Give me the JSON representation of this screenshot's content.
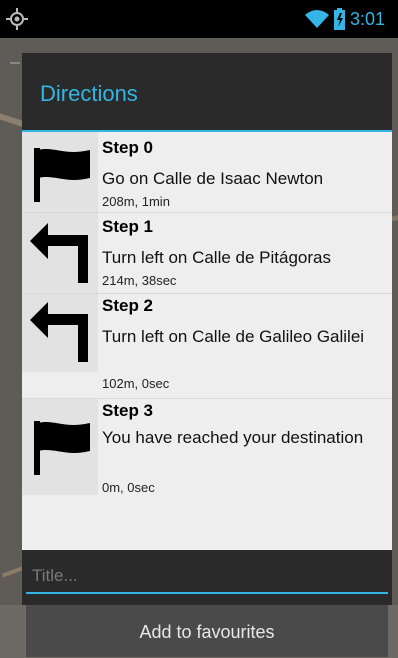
{
  "status_bar": {
    "time": "3:01",
    "icons": [
      "location-icon",
      "wifi-icon",
      "battery-charging-icon"
    ],
    "accent_color": "#33b5e5"
  },
  "dialog": {
    "title": "Directions",
    "accent_color": "#33b5e5",
    "steps": [
      {
        "title": "Step 0",
        "instruction": " Go on Calle de Isaac Newton",
        "meta": "208m, 1min",
        "icon": "flag-icon"
      },
      {
        "title": "Step 1",
        "instruction": "Turn left  on Calle de Pitágoras",
        "meta": "214m, 38sec",
        "icon": "turn-left-icon"
      },
      {
        "title": "Step 2",
        "instruction": "Turn left  on Calle de Galileo Galilei",
        "meta": "102m, 0sec",
        "icon": "turn-left-icon"
      },
      {
        "title": "Step 3",
        "instruction": "You have reached your destination",
        "meta": "0m, 0sec",
        "icon": "flag-icon"
      }
    ],
    "title_input": {
      "placeholder": "Title...",
      "value": ""
    },
    "add_button_label": "Add to favourites"
  }
}
